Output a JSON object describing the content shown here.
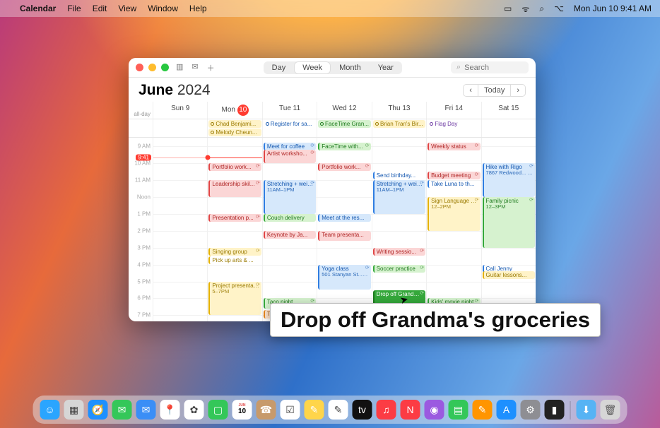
{
  "menubar": {
    "app": "Calendar",
    "items": [
      "File",
      "Edit",
      "View",
      "Window",
      "Help"
    ],
    "clock": "Mon Jun 10  9:41 AM"
  },
  "window": {
    "views": {
      "day": "Day",
      "week": "Week",
      "month": "Month",
      "year": "Year"
    },
    "search_placeholder": "Search",
    "month": "June",
    "year": "2024",
    "today_label": "Today",
    "prev": "‹",
    "next": "›",
    "allday_label": "all-day",
    "now_time": "9:41",
    "hours": [
      "9 AM",
      "10 AM",
      "11 AM",
      "Noon",
      "1 PM",
      "2 PM",
      "3 PM",
      "4 PM",
      "5 PM",
      "6 PM",
      "7 PM"
    ]
  },
  "days": [
    {
      "label": "Sun 9",
      "num": "9",
      "today": false
    },
    {
      "label": "Mon",
      "num": "10",
      "today": true
    },
    {
      "label": "Tue 11",
      "num": "11",
      "today": false
    },
    {
      "label": "Wed 12",
      "num": "12",
      "today": false
    },
    {
      "label": "Thu 13",
      "num": "13",
      "today": false
    },
    {
      "label": "Fri 14",
      "num": "14",
      "today": false
    },
    {
      "label": "Sat 15",
      "num": "15",
      "today": false
    }
  ],
  "allday": [
    [],
    [
      {
        "title": "Chad Benjami...",
        "color": "yellow"
      },
      {
        "title": "Melody Cheun...",
        "color": "yellow"
      }
    ],
    [
      {
        "title": "Register for sa...",
        "color": "blue-line"
      }
    ],
    [
      {
        "title": "FaceTime Gran...",
        "color": "green"
      }
    ],
    [
      {
        "title": "Brian Tran's Bir...",
        "color": "yellow"
      }
    ],
    [
      {
        "title": "Flag Day",
        "color": "purple-line"
      }
    ],
    []
  ],
  "events": {
    "0": [],
    "1": [
      {
        "title": "Portfolio work...",
        "start": 10,
        "end": 10.4,
        "color": "red",
        "recur": true
      },
      {
        "title": "Leadership skil...",
        "start": 11,
        "end": 12,
        "color": "red",
        "recur": true
      },
      {
        "title": "Presentation p...",
        "start": 13,
        "end": 13.4,
        "color": "red",
        "recur": true
      },
      {
        "title": "Singing group",
        "start": 15,
        "end": 15.4,
        "color": "yellow",
        "recur": true
      },
      {
        "title": "Pick up arts & ...",
        "start": 15.5,
        "end": 15.9,
        "color": "yellow-line"
      },
      {
        "title": "Project presentations",
        "sub": "5–7PM",
        "start": 17,
        "end": 19,
        "color": "yellow",
        "recur": true
      }
    ],
    "2": [
      {
        "title": "Meet for coffee",
        "start": 8.8,
        "end": 9.2,
        "color": "blue",
        "recur": true
      },
      {
        "title": "Artist worksho...",
        "start": 9.2,
        "end": 10,
        "color": "red",
        "recur": true
      },
      {
        "title": "Stretching + weights",
        "sub": "11AM–1PM",
        "start": 11,
        "end": 13,
        "color": "blue",
        "recur": true
      },
      {
        "title": "Couch delivery",
        "start": 13,
        "end": 13.4,
        "color": "green"
      },
      {
        "title": "Keynote by Ja...",
        "start": 14,
        "end": 14.4,
        "color": "red"
      },
      {
        "title": "Taco night",
        "start": 18,
        "end": 18.6,
        "color": "green",
        "recur": true
      },
      {
        "title": "Tutoring session",
        "start": 18.7,
        "end": 19.2,
        "color": "orange"
      }
    ],
    "3": [
      {
        "title": "FaceTime with...",
        "start": 8.8,
        "end": 9.2,
        "color": "green",
        "recur": true
      },
      {
        "title": "Portfolio work...",
        "start": 10,
        "end": 10.4,
        "color": "red",
        "recur": true
      },
      {
        "title": "Meet at the res...",
        "start": 13,
        "end": 13.4,
        "color": "blue"
      },
      {
        "title": "Team presenta...",
        "start": 14,
        "end": 14.6,
        "color": "red"
      },
      {
        "title": "Yoga class",
        "sub": "501 Stanyan St...  ⏱ 4–5:30PM",
        "start": 16,
        "end": 17.5,
        "color": "blue",
        "recur": true
      }
    ],
    "4": [
      {
        "title": "Send birthday...",
        "start": 10.5,
        "end": 10.9,
        "color": "blue-line"
      },
      {
        "title": "Stretching + weights",
        "sub": "11AM–1PM",
        "start": 11,
        "end": 13,
        "color": "blue",
        "recur": true
      },
      {
        "title": "Writing sessio...",
        "start": 15,
        "end": 15.4,
        "color": "red",
        "recur": true
      },
      {
        "title": "Soccer practice",
        "start": 16,
        "end": 16.4,
        "color": "green",
        "recur": true
      },
      {
        "title": "Drop off Grandma's groceries",
        "start": 17.5,
        "end": 18.6,
        "color": "green-solid",
        "recur": true
      }
    ],
    "5": [
      {
        "title": "Weekly status",
        "start": 8.8,
        "end": 9.2,
        "color": "red",
        "recur": true
      },
      {
        "title": "Budget meeting",
        "start": 10.5,
        "end": 10.9,
        "color": "red",
        "recur": true
      },
      {
        "title": "Take Luna to th...",
        "start": 11,
        "end": 11.4,
        "color": "blue-line"
      },
      {
        "title": "Sign Language Club",
        "sub": "12–2PM",
        "start": 12,
        "end": 14,
        "color": "yellow",
        "recur": true
      },
      {
        "title": "Kids' movie night",
        "start": 18,
        "end": 19,
        "color": "green",
        "recur": true
      }
    ],
    "6": [
      {
        "title": "Hike with Rigo",
        "sub": "7867 Redwood...  ⏱ 10AM–12PM",
        "start": 10,
        "end": 12,
        "color": "blue",
        "recur": true
      },
      {
        "title": "Family picnic",
        "sub": "12–3PM",
        "start": 12,
        "end": 15,
        "color": "green",
        "recur": true
      },
      {
        "title": "Call Jenny",
        "start": 16,
        "end": 16.4,
        "color": "blue-line"
      },
      {
        "title": "Guitar lessons...",
        "start": 16.4,
        "end": 16.8,
        "color": "yellow"
      }
    ]
  },
  "tooltip": "Drop off Grandma's groceries",
  "dock": [
    {
      "name": "finder",
      "bg": "#2aa5ff",
      "glyph": "☺"
    },
    {
      "name": "launchpad",
      "bg": "#d6d6d6",
      "glyph": "▦"
    },
    {
      "name": "safari",
      "bg": "#1e90ff",
      "glyph": "🧭"
    },
    {
      "name": "messages",
      "bg": "#34c759",
      "glyph": "✉"
    },
    {
      "name": "mail",
      "bg": "#3a8ef6",
      "glyph": "✉"
    },
    {
      "name": "maps",
      "bg": "#fff",
      "glyph": "📍"
    },
    {
      "name": "photos",
      "bg": "#fff",
      "glyph": "✿"
    },
    {
      "name": "facetime",
      "bg": "#34c759",
      "glyph": "▢"
    },
    {
      "name": "calendar",
      "bg": "#fff",
      "glyph": "10"
    },
    {
      "name": "contacts",
      "bg": "#c79a6b",
      "glyph": "☎"
    },
    {
      "name": "reminders",
      "bg": "#fff",
      "glyph": "☑"
    },
    {
      "name": "notes",
      "bg": "#ffd54a",
      "glyph": "✎"
    },
    {
      "name": "freeform",
      "bg": "#fff",
      "glyph": "✎"
    },
    {
      "name": "tv",
      "bg": "#111",
      "glyph": "tv"
    },
    {
      "name": "music",
      "bg": "#fc3c44",
      "glyph": "♫"
    },
    {
      "name": "news",
      "bg": "#fc3c44",
      "glyph": "N"
    },
    {
      "name": "podcasts",
      "bg": "#9b59e0",
      "glyph": "◉"
    },
    {
      "name": "numbers",
      "bg": "#34c759",
      "glyph": "▤"
    },
    {
      "name": "pages",
      "bg": "#ff9500",
      "glyph": "✎"
    },
    {
      "name": "appstore",
      "bg": "#1e90ff",
      "glyph": "A"
    },
    {
      "name": "settings",
      "bg": "#8e8e93",
      "glyph": "⚙"
    },
    {
      "name": "iphone-mirror",
      "bg": "#222",
      "glyph": "▮"
    }
  ],
  "dock_right": [
    {
      "name": "downloads",
      "bg": "#56b3f4",
      "glyph": "⬇"
    },
    {
      "name": "trash",
      "bg": "#d6d6d6",
      "glyph": "🗑"
    }
  ]
}
